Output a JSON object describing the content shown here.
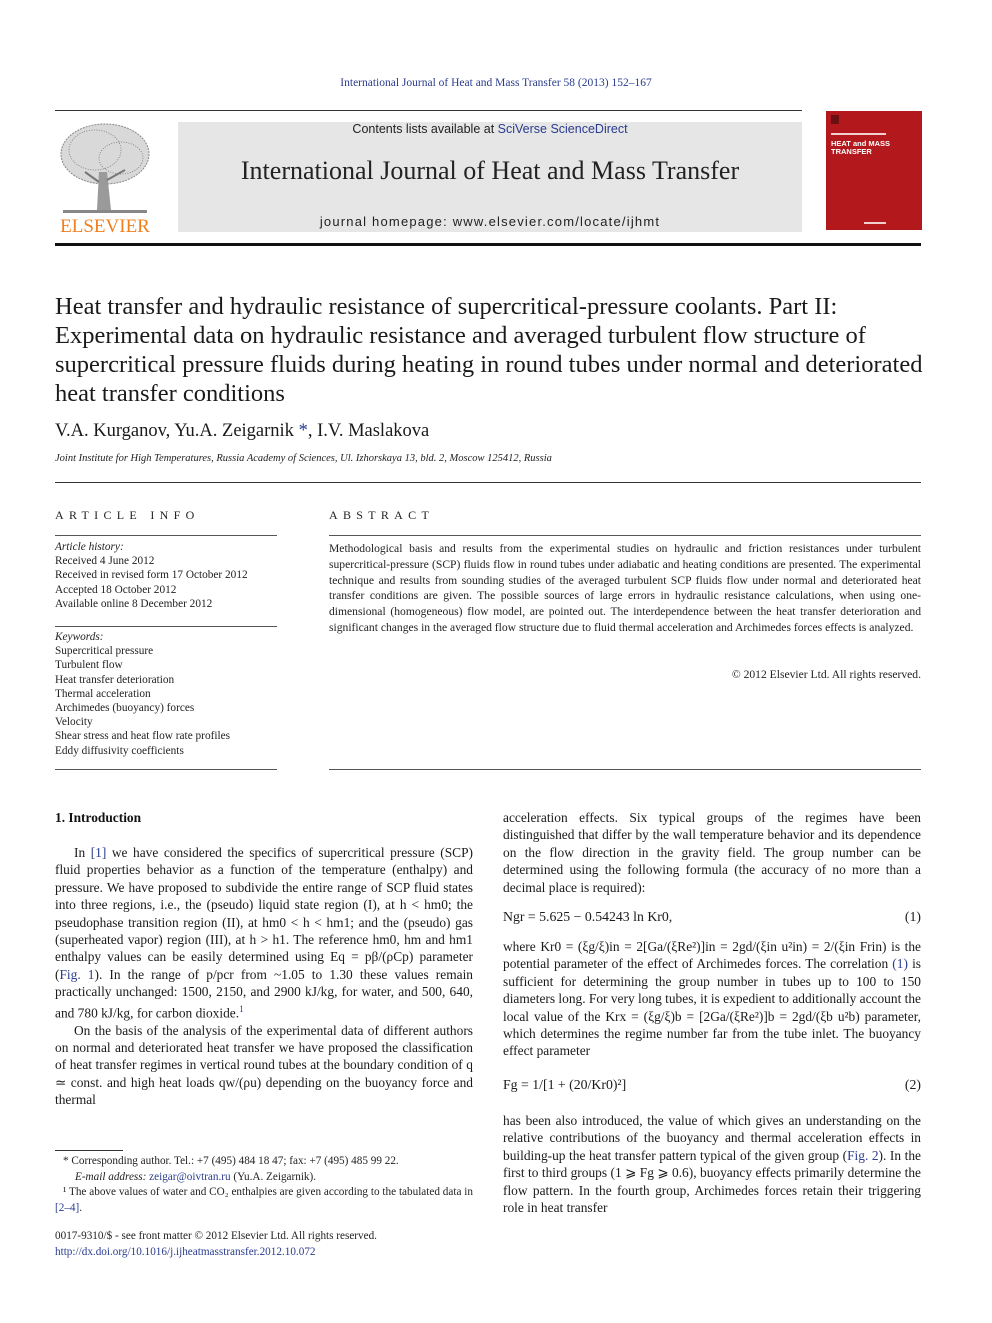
{
  "citation": "International Journal of Heat and Mass Transfer 58 (2013) 152–167",
  "header": {
    "publisher": "ELSEVIER",
    "contents_prefix": "Contents lists available at ",
    "contents_link": "SciVerse ScienceDirect",
    "journal_title": "International Journal of Heat and Mass Transfer",
    "homepage": "journal homepage: www.elsevier.com/locate/ijhmt",
    "cover_title_line1": "HEAT and MASS",
    "cover_title_line2": "TRANSFER"
  },
  "article": {
    "title": "Heat transfer and hydraulic resistance of supercritical-pressure coolants. Part II: Experimental data on hydraulic resistance and averaged turbulent flow structure of supercritical pressure fluids during heating in round tubes under normal and deteriorated heat transfer conditions",
    "authors_part1": "V.A. Kurganov, Yu.A. Zeigarnik",
    "author_mark": "*",
    "authors_part2": ", I.V. Maslakova",
    "affiliation": "Joint Institute for High Temperatures, Russia Academy of Sciences, Ul. Izhorskaya 13, bld. 2, Moscow 125412, Russia"
  },
  "article_info": {
    "heading": "ARTICLE INFO",
    "history_label": "Article history:",
    "history": [
      "Received 4 June 2012",
      "Received in revised form 17 October 2012",
      "Accepted 18 October 2012",
      "Available online 8 December 2012"
    ],
    "keywords_label": "Keywords:",
    "keywords": [
      "Supercritical pressure",
      "Turbulent flow",
      "Heat transfer deterioration",
      "Thermal acceleration",
      "Archimedes (buoyancy) forces",
      "Velocity",
      "Shear stress and heat flow rate profiles",
      "Eddy diffusivity coefficients"
    ]
  },
  "abstract": {
    "heading": "ABSTRACT",
    "text": "Methodological basis and results from the experimental studies on hydraulic and friction resistances under turbulent supercritical-pressure (SCP) fluids flow in round tubes under adiabatic and heating conditions are presented. The experimental technique and results from sounding studies of the averaged turbulent SCP fluids flow under normal and deteriorated heat transfer conditions are given. The possible sources of large errors in hydraulic resistance calculations, when using one-dimensional (homogeneous) flow model, are pointed out. The interdependence between the heat transfer deterioration and significant changes in the averaged flow structure due to fluid thermal acceleration and Archimedes forces effects is analyzed.",
    "copyright": "© 2012 Elsevier Ltd. All rights reserved."
  },
  "intro": {
    "heading": "1. Introduction",
    "p1_a": "In ",
    "p1_ref": "[1]",
    "p1_b": " we have considered the specifics of supercritical pressure (SCP) fluid properties behavior as a function of the temperature (enthalpy) and pressure. We have proposed to subdivide the entire range of SCP fluid states into three regions, i.e., the (pseudo) liquid state region (I), at h < hm0; the pseudophase transition region (II), at hm0 < h < hm1; and the (pseudo) gas (superheated vapor) region (III), at h > h1. The reference hm0, hm and hm1 enthalpy values can be easily determined using Eq = pβ/(ρCp) parameter (",
    "p1_fig": "Fig. 1",
    "p1_c": "). In the range of p/pcr from ~1.05 to 1.30 these values remain practically unchanged: 1500, 2150, and 2900 kJ/kg, for water, and 500, 640, and 780 kJ/kg, for carbon dioxide.",
    "p1_fn": "1",
    "p2": "On the basis of the analysis of the experimental data of different authors on normal and deteriorated heat transfer we have proposed the classification of heat transfer regimes in vertical round tubes at the boundary condition of q ≃ const. and high heat loads qw/(ρu) depending on the buoyancy force and thermal",
    "right_p1": "acceleration effects. Six typical groups of the regimes have been distinguished that differ by the wall temperature behavior and its dependence on the flow direction in the gravity field. The group number can be determined using the following formula (the accuracy of no more than a decimal place is required):",
    "eq1": "Ngr = 5.625 − 0.54243 ln Kr0,",
    "eq1_num": "(1)",
    "right_p2_a": "where Kr0 = (ξg/ξ)in = 2[Ga/(ξRe²)]in = 2gd/(ξin u²in) = 2/(ξin Frin) is the potential parameter of the effect of Archimedes forces. The correlation ",
    "right_p2_ref": "(1)",
    "right_p2_b": " is sufficient for determining the group number in tubes up to 100 to 150 diameters long. For very long tubes, it is expedient to additionally account the local value of the Krx = (ξg/ξ)b = [2Ga/(ξRe²)]b = 2gd/(ξb u²b) parameter, which determines the regime number far from the tube inlet. The buoyancy effect parameter",
    "eq2": "Fg = 1/[1 + (20/Kr0)²]",
    "eq2_num": "(2)",
    "right_p3_a": "has been also introduced, the value of which gives an understanding on the relative contributions of the buoyancy and thermal acceleration effects in building-up the heat transfer pattern typical of the given group (",
    "right_p3_fig": "Fig. 2",
    "right_p3_b": "). In the first to third groups (1 ⩾ Fg ⩾ 0.6), buoyancy effects primarily determine the flow pattern. In the fourth group, Archimedes forces retain their triggering role in heat transfer"
  },
  "footnotes": {
    "corresponding": "* Corresponding author. Tel.: +7 (495) 484 18 47; fax: +7 (495) 485 99 22.",
    "email_label": "E-mail address: ",
    "email": "zeigar@oivtran.ru",
    "email_suffix": " (Yu.A. Zeigarnik).",
    "fn1_a": "¹ The above values of water and CO₂ enthalpies are given according to the tabulated data in ",
    "fn1_ref": "[2–4]",
    "fn1_b": ".",
    "issn": "0017-9310/$ - see front matter © 2012 Elsevier Ltd. All rights reserved.",
    "doi": "http://dx.doi.org/10.1016/j.ijheatmasstransfer.2012.10.072"
  }
}
